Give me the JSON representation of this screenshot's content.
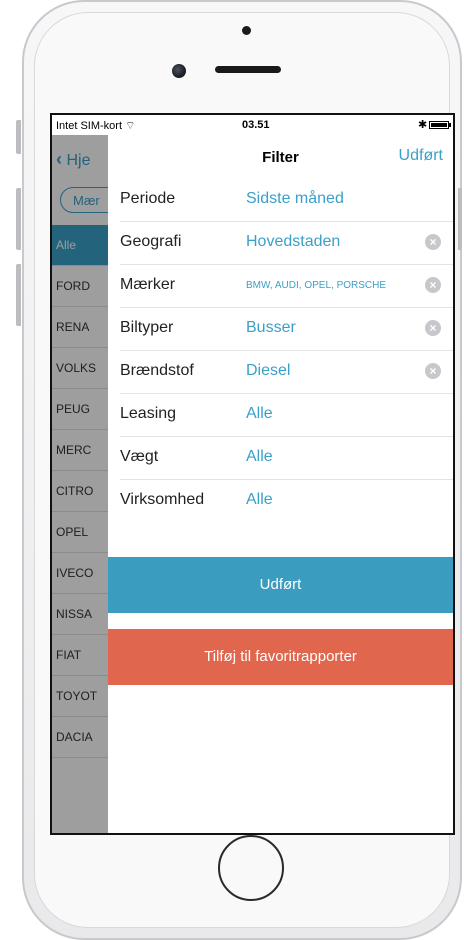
{
  "status": {
    "carrier": "Intet SIM-kort",
    "time": "03.51",
    "bluetooth": "✱"
  },
  "background": {
    "back_label": "Hje",
    "pill_label": "Mær",
    "items": [
      "Alle",
      "FORD",
      "RENA",
      "VOLKS",
      "PEUG",
      "MERC",
      "CITRO",
      "OPEL",
      "IVECO",
      "NISSA",
      "FIAT",
      "TOYOT",
      "DACIA"
    ]
  },
  "nav": {
    "title": "Filter",
    "done": "Udført"
  },
  "filters": [
    {
      "label": "Periode",
      "value": "Sidste måned",
      "clearable": false
    },
    {
      "label": "Geografi",
      "value": "Hovedstaden",
      "clearable": true
    },
    {
      "label": "Mærker",
      "value": "BMW, AUDI, OPEL, PORSCHE",
      "clearable": true
    },
    {
      "label": "Biltyper",
      "value": "Busser",
      "clearable": true
    },
    {
      "label": "Brændstof",
      "value": "Diesel",
      "clearable": true
    },
    {
      "label": "Leasing",
      "value": "Alle",
      "clearable": false
    },
    {
      "label": "Vægt",
      "value": "Alle",
      "clearable": false
    },
    {
      "label": "Virksomhed",
      "value": "Alle",
      "clearable": false
    }
  ],
  "buttons": {
    "done": "Udført",
    "favorite": "Tilføj til favoritrapporter"
  },
  "colors": {
    "accent": "#3aa0c8",
    "done_button": "#3a9cbf",
    "favorite_button": "#e0664d"
  }
}
